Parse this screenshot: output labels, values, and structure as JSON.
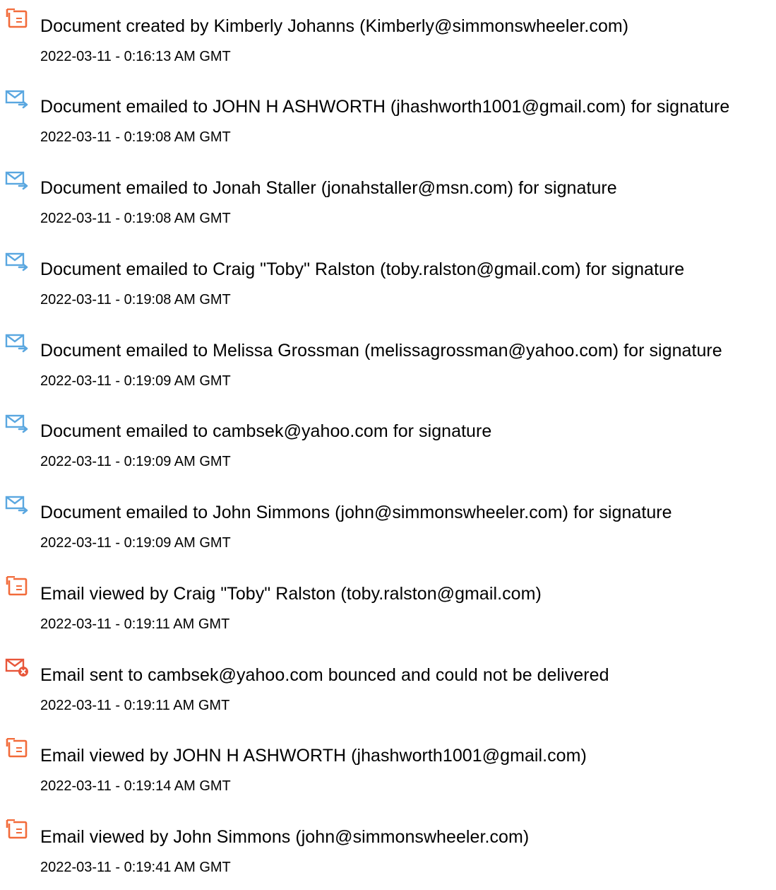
{
  "colors": {
    "doc_icon": "#f26b3a",
    "email_icon": "#5aa7e0",
    "bounce_icon": "#e8563a"
  },
  "events": [
    {
      "icon": "document-icon",
      "text": "Document created by Kimberly Johanns (Kimberly@simmonswheeler.com)",
      "time": "2022-03-11 - 0:16:13 AM GMT"
    },
    {
      "icon": "email-sent-icon",
      "text": "Document emailed to JOHN H ASHWORTH (jhashworth1001@gmail.com) for signature",
      "time": "2022-03-11 - 0:19:08 AM GMT"
    },
    {
      "icon": "email-sent-icon",
      "text": "Document emailed to Jonah Staller (jonahstaller@msn.com) for signature",
      "time": "2022-03-11 - 0:19:08 AM GMT"
    },
    {
      "icon": "email-sent-icon",
      "text": "Document emailed to Craig \"Toby\" Ralston (toby.ralston@gmail.com) for signature",
      "time": "2022-03-11 - 0:19:08 AM GMT"
    },
    {
      "icon": "email-sent-icon",
      "text": "Document emailed to Melissa Grossman (melissagrossman@yahoo.com) for signature",
      "time": "2022-03-11 - 0:19:09 AM GMT"
    },
    {
      "icon": "email-sent-icon",
      "text": "Document emailed to cambsek@yahoo.com for signature",
      "time": "2022-03-11 - 0:19:09 AM GMT"
    },
    {
      "icon": "email-sent-icon",
      "text": "Document emailed to John Simmons (john@simmonswheeler.com) for signature",
      "time": "2022-03-11 - 0:19:09 AM GMT"
    },
    {
      "icon": "document-icon",
      "text": "Email viewed by Craig \"Toby\" Ralston (toby.ralston@gmail.com)",
      "time": "2022-03-11 - 0:19:11 AM GMT"
    },
    {
      "icon": "email-bounced-icon",
      "text": "Email sent to cambsek@yahoo.com bounced and could not be delivered",
      "time": "2022-03-11 - 0:19:11 AM GMT"
    },
    {
      "icon": "document-icon",
      "text": "Email viewed by JOHN H ASHWORTH (jhashworth1001@gmail.com)",
      "time": "2022-03-11 - 0:19:14 AM GMT"
    },
    {
      "icon": "document-icon",
      "text": "Email viewed by John Simmons (john@simmonswheeler.com)",
      "time": "2022-03-11 - 0:19:41 AM GMT"
    }
  ]
}
